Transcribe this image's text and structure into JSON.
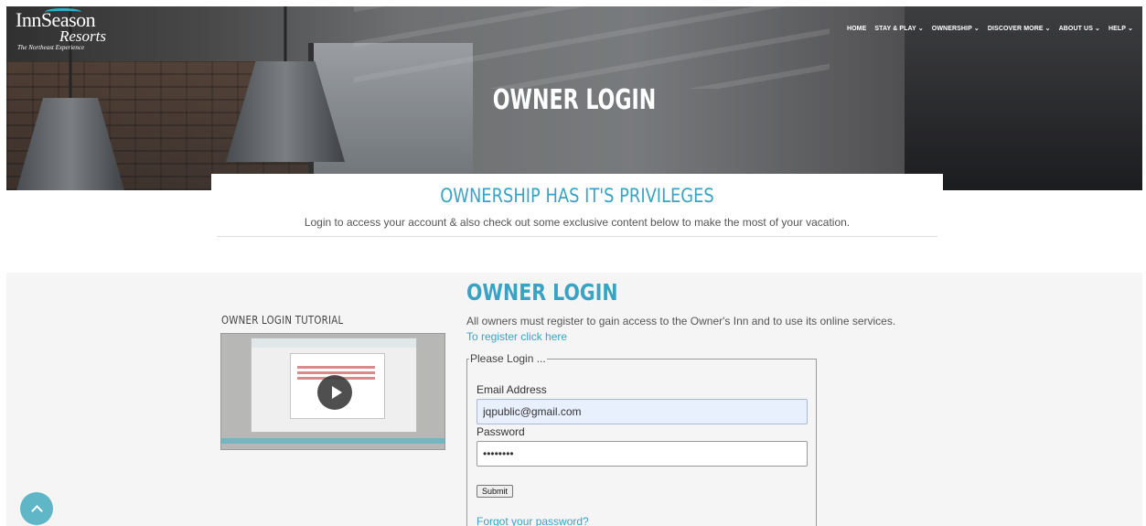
{
  "brand": {
    "name_line1": "InnSeason",
    "name_line2": "Resorts",
    "tagline": "The Northeast Experience"
  },
  "nav": {
    "items": [
      {
        "label": "HOME",
        "has_dropdown": false
      },
      {
        "label": "STAY & PLAY",
        "has_dropdown": true
      },
      {
        "label": "OWNERSHIP",
        "has_dropdown": true
      },
      {
        "label": "DISCOVER MORE",
        "has_dropdown": true
      },
      {
        "label": "ABOUT US",
        "has_dropdown": true
      },
      {
        "label": "HELP",
        "has_dropdown": true
      }
    ],
    "chevron": "⌄"
  },
  "hero": {
    "title": "OWNER LOGIN"
  },
  "intro": {
    "heading": "OWNERSHIP HAS IT'S PRIVILEGES",
    "text": "Login to access your account & also check out some exclusive content below to make the most of your vacation."
  },
  "tutorial": {
    "title": "OWNER LOGIN TUTORIAL",
    "icon": "play-icon"
  },
  "login": {
    "title": "OWNER LOGIN",
    "description": "All owners must register to gain access to the Owner's Inn and to use its online services.",
    "register_link": "To register click here",
    "legend": "Please Login ...",
    "email_label": "Email Address",
    "email_value": "jqpublic@gmail.com",
    "password_label": "Password",
    "password_value": "abcdefgh",
    "submit_label": "Submit",
    "forgot_link": "Forgot your password?"
  },
  "colors": {
    "accent": "#3aa3c4",
    "scroll_button": "#5fb6c6",
    "lower_background": "#f5f5f5"
  }
}
